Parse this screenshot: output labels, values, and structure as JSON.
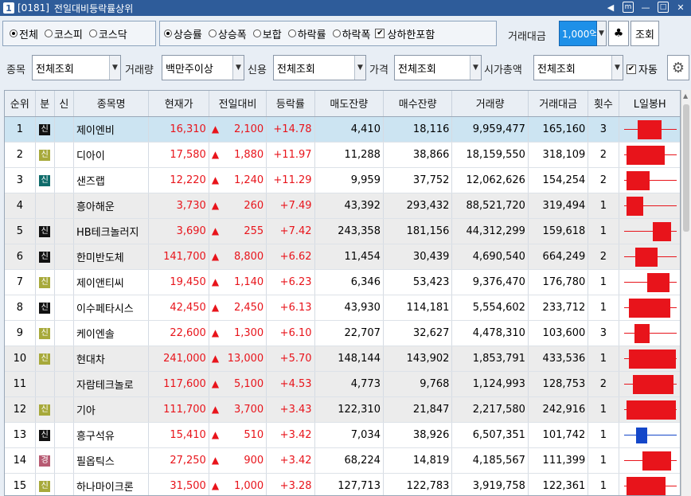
{
  "window": {
    "screen_no": "[0181]",
    "title": "전일대비등락률상위",
    "icon_label": "1"
  },
  "filters": {
    "market": [
      {
        "label": "전체",
        "selected": true
      },
      {
        "label": "코스피",
        "selected": false
      },
      {
        "label": "코스닥",
        "selected": false
      }
    ],
    "direction": [
      {
        "label": "상승률",
        "selected": true
      },
      {
        "label": "상승폭",
        "selected": false
      },
      {
        "label": "보합",
        "selected": false
      },
      {
        "label": "하락률",
        "selected": false
      },
      {
        "label": "하락폭",
        "selected": false
      }
    ],
    "include_limit_label": "상하한포함",
    "include_limit_checked": true,
    "amount_label": "거래대금",
    "amount_value": "1,000억",
    "query_button": "조회",
    "stock_label": "종목",
    "stock_value": "전체조회",
    "volume_label": "거래량",
    "volume_value": "백만주이상",
    "credit_label": "신용",
    "credit_value": "전체조회",
    "price_label": "가격",
    "price_value": "전체조회",
    "marketcap_label": "시가총액",
    "marketcap_value": "전체조회",
    "auto_label": "자동",
    "auto_checked": true
  },
  "columns": [
    "순위",
    "분",
    "신",
    "종목명",
    "현재가",
    "전일대비",
    "등락률",
    "매도잔량",
    "매수잔량",
    "거래량",
    "거래대금",
    "횟수",
    "L일봉H"
  ],
  "rows": [
    {
      "rank": "1",
      "badge": "신",
      "badge_color": "black",
      "name": "제이엔비",
      "price": "16,310",
      "change": "2,100",
      "rate": "+14.78",
      "ask": "4,410",
      "bid": "18,116",
      "volume": "9,959,477",
      "amount": "165,160",
      "count": "3",
      "candle_low": 0.0,
      "candle_open": 0.26,
      "candle_close": 0.72,
      "candle_high": 1.0,
      "candle_up": true,
      "style": "sel"
    },
    {
      "rank": "2",
      "badge": "신",
      "badge_color": "olive",
      "name": "디아이",
      "price": "17,580",
      "change": "1,880",
      "rate": "+11.97",
      "ask": "11,288",
      "bid": "38,866",
      "volume": "18,159,550",
      "amount": "318,109",
      "count": "2",
      "candle_low": 0.0,
      "candle_open": 0.05,
      "candle_close": 0.78,
      "candle_high": 1.0,
      "candle_up": true,
      "style": ""
    },
    {
      "rank": "3",
      "badge": "신",
      "badge_color": "teal",
      "name": "샌즈랩",
      "price": "12,220",
      "change": "1,240",
      "rate": "+11.29",
      "ask": "9,959",
      "bid": "37,752",
      "volume": "12,062,626",
      "amount": "154,254",
      "count": "2",
      "candle_low": 0.0,
      "candle_open": 0.05,
      "candle_close": 0.5,
      "candle_high": 1.0,
      "candle_up": true,
      "style": ""
    },
    {
      "rank": "4",
      "badge": "",
      "badge_color": "",
      "name": "흥아해운",
      "price": "3,730",
      "change": "260",
      "rate": "+7.49",
      "ask": "43,392",
      "bid": "293,432",
      "volume": "88,521,720",
      "amount": "319,494",
      "count": "1",
      "candle_low": 0.0,
      "candle_open": 0.05,
      "candle_close": 0.37,
      "candle_high": 1.0,
      "candle_up": true,
      "style": "gray"
    },
    {
      "rank": "5",
      "badge": "신",
      "badge_color": "black",
      "name": "HB테크놀러지",
      "price": "3,690",
      "change": "255",
      "rate": "+7.42",
      "ask": "243,358",
      "bid": "181,156",
      "volume": "44,312,299",
      "amount": "159,618",
      "count": "1",
      "candle_low": 0.0,
      "candle_open": 0.55,
      "candle_close": 0.9,
      "candle_high": 1.0,
      "candle_up": true,
      "style": "gray"
    },
    {
      "rank": "6",
      "badge": "신",
      "badge_color": "black",
      "name": "한미반도체",
      "price": "141,700",
      "change": "8,800",
      "rate": "+6.62",
      "ask": "11,454",
      "bid": "30,439",
      "volume": "4,690,540",
      "amount": "664,249",
      "count": "2",
      "candle_low": 0.0,
      "candle_open": 0.22,
      "candle_close": 0.65,
      "candle_high": 1.0,
      "candle_up": true,
      "style": "gray"
    },
    {
      "rank": "7",
      "badge": "신",
      "badge_color": "olive",
      "name": "제이앤티씨",
      "price": "19,450",
      "change": "1,140",
      "rate": "+6.23",
      "ask": "6,346",
      "bid": "53,423",
      "volume": "9,376,470",
      "amount": "176,780",
      "count": "1",
      "candle_low": 0.0,
      "candle_open": 0.45,
      "candle_close": 0.87,
      "candle_high": 1.0,
      "candle_up": true,
      "style": ""
    },
    {
      "rank": "8",
      "badge": "신",
      "badge_color": "black",
      "name": "이수페타시스",
      "price": "42,450",
      "change": "2,450",
      "rate": "+6.13",
      "ask": "43,930",
      "bid": "114,181",
      "volume": "5,554,602",
      "amount": "233,712",
      "count": "1",
      "candle_low": 0.0,
      "candle_open": 0.1,
      "candle_close": 0.88,
      "candle_high": 1.0,
      "candle_up": true,
      "style": ""
    },
    {
      "rank": "9",
      "badge": "신",
      "badge_color": "olive",
      "name": "케이엔솔",
      "price": "22,600",
      "change": "1,300",
      "rate": "+6.10",
      "ask": "22,707",
      "bid": "32,627",
      "volume": "4,478,310",
      "amount": "103,600",
      "count": "3",
      "candle_low": 0.0,
      "candle_open": 0.2,
      "candle_close": 0.5,
      "candle_high": 1.0,
      "candle_up": true,
      "style": ""
    },
    {
      "rank": "10",
      "badge": "신",
      "badge_color": "olive",
      "name": "현대차",
      "price": "241,000",
      "change": "13,000",
      "rate": "+5.70",
      "ask": "148,144",
      "bid": "143,902",
      "volume": "1,853,791",
      "amount": "433,536",
      "count": "1",
      "candle_low": 0.0,
      "candle_open": 0.1,
      "candle_close": 1.0,
      "candle_high": 1.0,
      "candle_up": true,
      "style": "gray"
    },
    {
      "rank": "11",
      "badge": "",
      "badge_color": "",
      "name": "자람테크놀로",
      "price": "117,600",
      "change": "5,100",
      "rate": "+4.53",
      "ask": "4,773",
      "bid": "9,768",
      "volume": "1,124,993",
      "amount": "128,753",
      "count": "2",
      "candle_low": 0.0,
      "candle_open": 0.18,
      "candle_close": 0.95,
      "candle_high": 1.0,
      "candle_up": true,
      "style": "gray"
    },
    {
      "rank": "12",
      "badge": "신",
      "badge_color": "olive",
      "name": "기아",
      "price": "111,700",
      "change": "3,700",
      "rate": "+3.43",
      "ask": "122,310",
      "bid": "21,847",
      "volume": "2,217,580",
      "amount": "242,916",
      "count": "1",
      "candle_low": 0.0,
      "candle_open": 0.05,
      "candle_close": 1.0,
      "candle_high": 1.0,
      "candle_up": true,
      "style": "gray"
    },
    {
      "rank": "13",
      "badge": "신",
      "badge_color": "black",
      "name": "흥구석유",
      "price": "15,410",
      "change": "510",
      "rate": "+3.42",
      "ask": "7,034",
      "bid": "38,926",
      "volume": "6,507,351",
      "amount": "101,742",
      "count": "1",
      "candle_low": 0.0,
      "candle_open": 0.24,
      "candle_close": 0.44,
      "candle_high": 1.0,
      "candle_up": false,
      "style": ""
    },
    {
      "rank": "14",
      "badge": "경",
      "badge_color": "rose",
      "name": "필옵틱스",
      "price": "27,250",
      "change": "900",
      "rate": "+3.42",
      "ask": "68,224",
      "bid": "14,819",
      "volume": "4,185,567",
      "amount": "111,399",
      "count": "1",
      "candle_low": 0.0,
      "candle_open": 0.35,
      "candle_close": 0.9,
      "candle_high": 1.0,
      "candle_up": true,
      "style": ""
    },
    {
      "rank": "15",
      "badge": "신",
      "badge_color": "olive",
      "name": "하나마이크론",
      "price": "31,500",
      "change": "1,000",
      "rate": "+3.28",
      "ask": "127,713",
      "bid": "122,783",
      "volume": "3,919,758",
      "amount": "122,361",
      "count": "1",
      "candle_low": 0.0,
      "candle_open": 0.05,
      "candle_close": 0.8,
      "candle_high": 1.0,
      "candle_up": true,
      "style": ""
    }
  ],
  "colors": {
    "up": "#e8141b",
    "down": "#1447c9",
    "selected_row": "#cce4f2",
    "title_bar": "#2e5c9a"
  }
}
